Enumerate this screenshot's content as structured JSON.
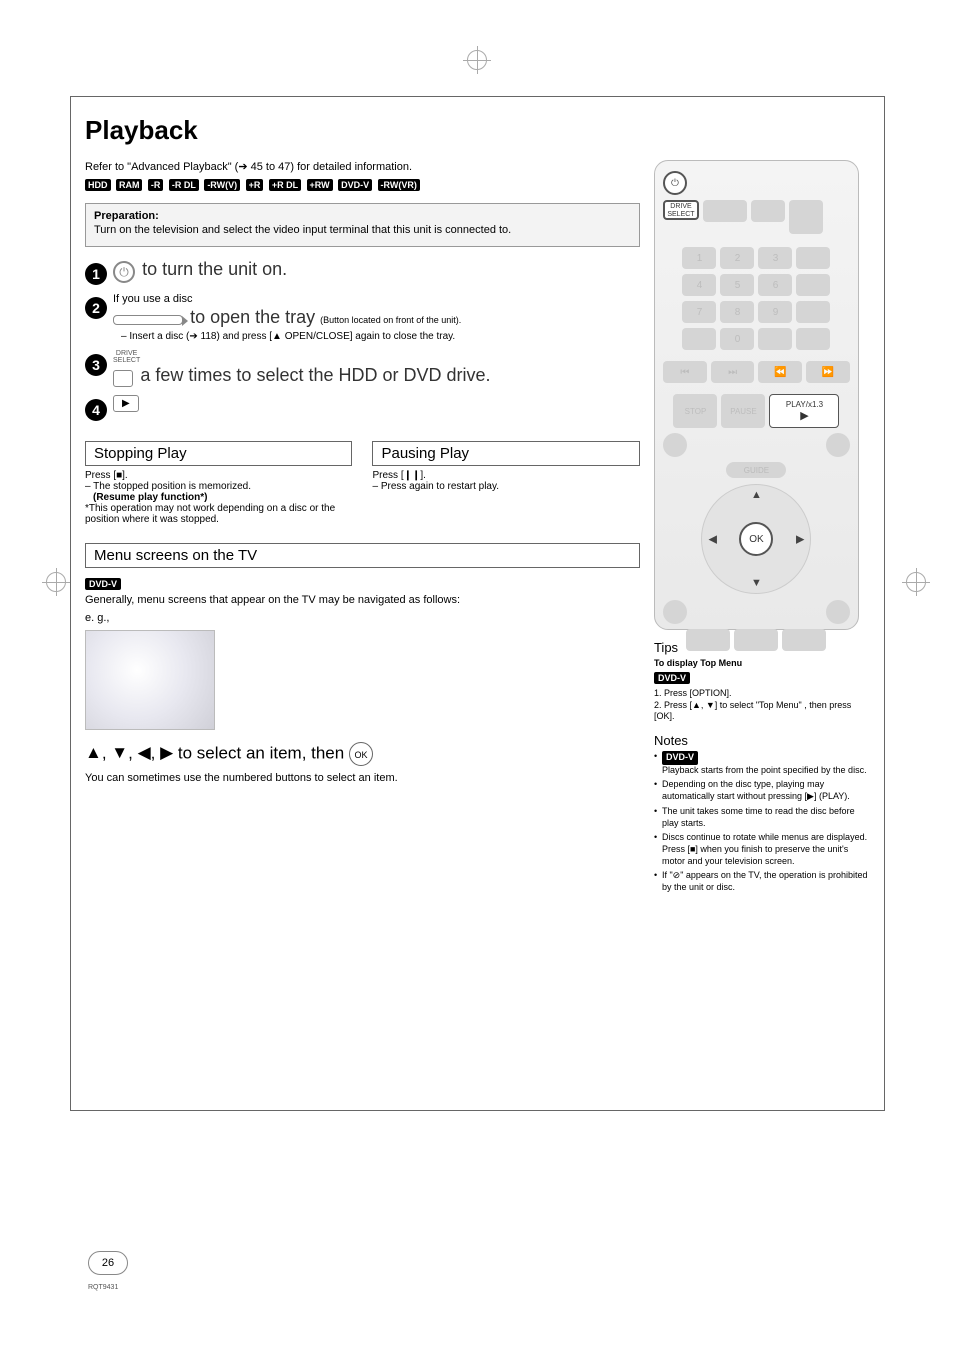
{
  "page": {
    "title": "Playback",
    "refline_a": "Refer to \"Advanced Playback\" (",
    "refline_b": " 45 to 47) for detailed information.",
    "tags": [
      "HDD",
      "RAM",
      "-R",
      "-R DL",
      "-RW(V)",
      "+R",
      "+R DL",
      "+RW",
      "DVD-V",
      "-RW(VR)"
    ],
    "prep": {
      "hdr": "Preparation:",
      "body": "Turn on the television and select the video input terminal that this unit is connected to."
    },
    "step1": {
      "text": " to turn the unit on."
    },
    "step2": {
      "intro": "If you use a disc",
      "main": " to open the tray ",
      "sub": "(Button located on front of the unit).",
      "bullet_a": "– Insert a disc (",
      "bullet_b": " 118) and press [▲ OPEN/CLOSE] again to close the tray."
    },
    "step3": {
      "label": "DRIVE\nSELECT",
      "text": " a few times to select the HDD or DVD drive."
    },
    "stopping": {
      "hdr": "Stopping Play",
      "l1": "Press [■].",
      "l2": "– The stopped position is memorized.",
      "l3": "(Resume play function*)",
      "l4": "*This operation may not work depending on a disc or the position where it was stopped."
    },
    "pausing": {
      "hdr": "Pausing Play",
      "l1": "Press [❙❙].",
      "l2": "– Press again to restart play."
    },
    "menu": {
      "hdr": "Menu screens on the TV",
      "tag": "DVD-V",
      "body": "Generally, menu screens that appear on the TV may be navigated as follows:",
      "eg": "e. g.,",
      "nav_a": " to select an item, then ",
      "note": "You can sometimes use the numbered buttons to select an item."
    },
    "remote": {
      "drive_select": "DRIVE\nSELECT",
      "stop": "STOP",
      "pause": "PAUSE",
      "play": "PLAY/x1.3",
      "guide": "GUIDE",
      "ok": "OK",
      "row_nums_top": [
        "1",
        "2",
        "3"
      ],
      "row_nums_mid": [
        "4",
        "5",
        "6"
      ],
      "row_nums_bot": [
        "7",
        "8",
        "9"
      ],
      "zero": "0"
    },
    "tips": {
      "hdr": "Tips",
      "sub1": "To display Top Menu",
      "tag": "DVD-V",
      "l1": "1. Press [OPTION].",
      "l2": "2. Press [▲, ▼] to select \"Top Menu\" , then press [OK]."
    },
    "notes": {
      "hdr": "Notes",
      "tag": "DVD-V",
      "n1": "Playback starts from the point specified by the disc.",
      "n2": "Depending on the disc type, playing may automatically start without pressing [▶] (PLAY).",
      "n3": "The unit takes some time to read the disc before play starts.",
      "n4": "Discs continue to rotate while menus are displayed. Press [■] when you finish to preserve the unit's motor and your television screen.",
      "n5": "If \"⊘\" appears on the TV, the operation is prohibited by the unit or disc."
    },
    "page_num": "26",
    "rqt": "RQT9431"
  }
}
